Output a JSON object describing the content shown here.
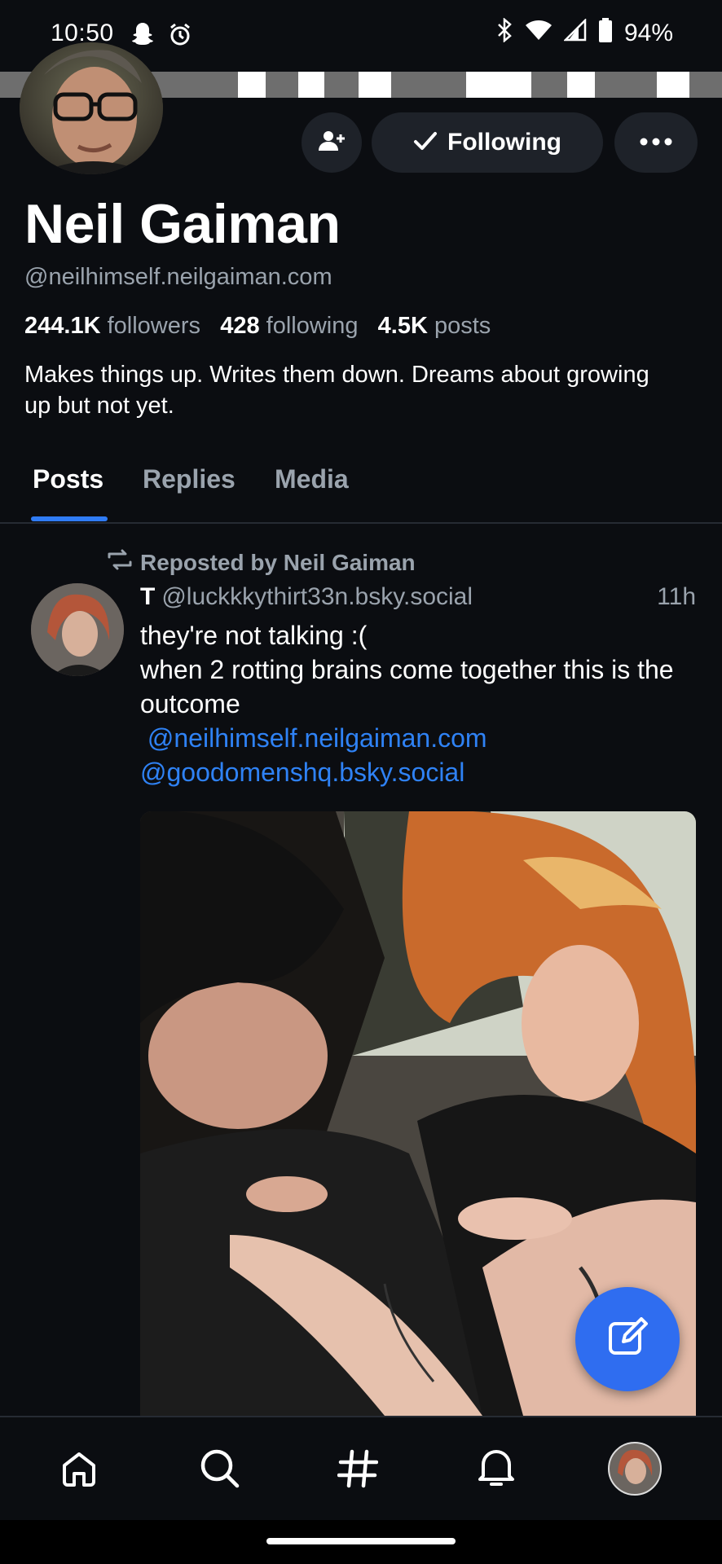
{
  "status_bar": {
    "time": "10:50",
    "battery": "94%",
    "icons": [
      "snapchat-icon",
      "alarm-icon",
      "bluetooth-icon",
      "wifi-icon",
      "cell-signal-icon",
      "battery-icon"
    ]
  },
  "profile": {
    "display_name": "Neil Gaiman",
    "handle": "@neilhimself.neilgaiman.com",
    "followers_count": "244.1K",
    "followers_label": "followers",
    "following_count": "428",
    "following_label": "following",
    "posts_count": "4.5K",
    "posts_label": "posts",
    "bio": "Makes things up. Writes them down. Dreams about growing up but not yet."
  },
  "actions": {
    "following_label": "Following",
    "more_label": "•••"
  },
  "tabs": [
    {
      "label": "Posts",
      "active": true
    },
    {
      "label": "Replies",
      "active": false
    },
    {
      "label": "Media",
      "active": false
    }
  ],
  "post": {
    "repost_label": "Reposted by Neil Gaiman",
    "author_initial": "T",
    "author_handle": "@luckkkythirt33n.bsky.social",
    "time": "11h",
    "text_line1": "they're not talking :(",
    "text_line2": "when 2 rotting brains come together this is the outcome",
    "mention1": " @neilhimself.neilgaiman.com",
    "mention2": "@goodomenshq.bsky.social"
  },
  "bottom_nav": [
    "home-icon",
    "search-icon",
    "feeds-hash-icon",
    "notifications-icon",
    "profile-avatar"
  ],
  "colors": {
    "background": "#0b0d11",
    "accent": "#2f7bf5",
    "muted_text": "#9aa3ad",
    "button_bg": "#1e2229"
  }
}
